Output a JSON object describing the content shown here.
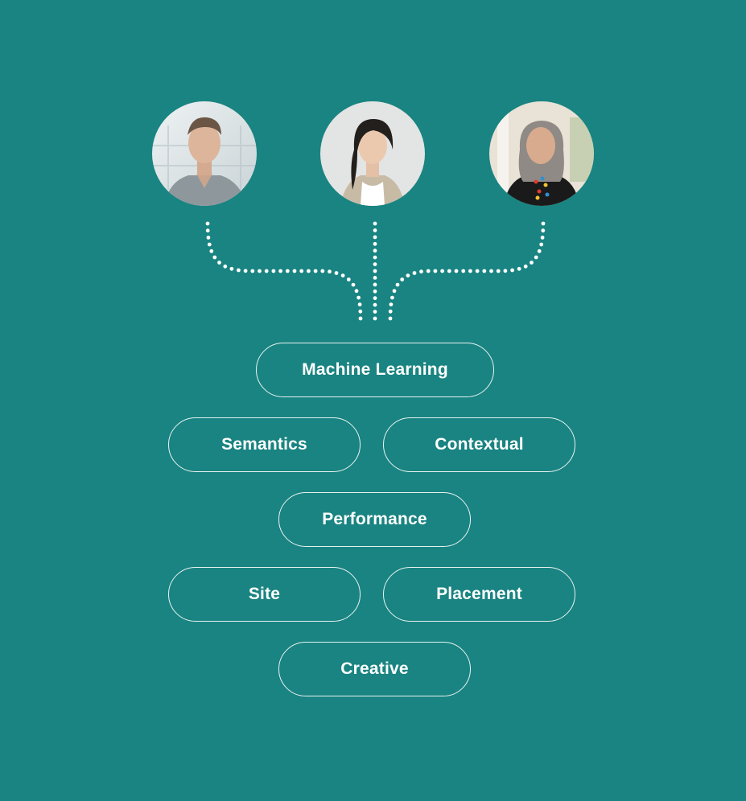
{
  "theme": {
    "background": "#198481",
    "pill_border": "#e8f3f2",
    "text": "#ffffff",
    "dot": "#ffffff"
  },
  "people": [
    {
      "name": "person-1",
      "description": "young man with short hair in grey shirt"
    },
    {
      "name": "person-2",
      "description": "woman with dark braided hair in beige cardigan"
    },
    {
      "name": "person-3",
      "description": "older woman with grey hair and colorful necklace"
    }
  ],
  "connectors": {
    "style": "dotted",
    "count": 3
  },
  "tags": [
    {
      "label": "Machine Learning"
    },
    {
      "label": "Semantics"
    },
    {
      "label": "Contextual"
    },
    {
      "label": "Performance"
    },
    {
      "label": "Site"
    },
    {
      "label": "Placement"
    },
    {
      "label": "Creative"
    }
  ]
}
